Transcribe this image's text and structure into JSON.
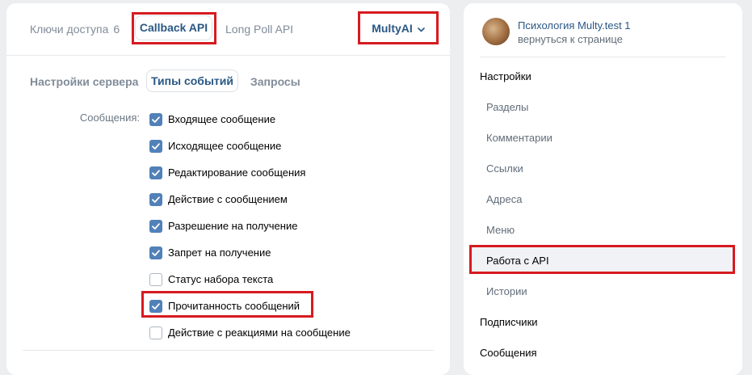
{
  "left_panel": {
    "top_tabs": {
      "keys_label": "Ключи доступа",
      "keys_count": "6",
      "callback": "Callback API",
      "longpoll": "Long Poll API",
      "app_name": "MultyAI"
    },
    "sub_tabs": {
      "server_settings": "Настройки сервера",
      "event_types": "Типы событий",
      "requests": "Запросы"
    },
    "messages_group_label": "Сообщения:",
    "events": [
      {
        "label": "Входящее сообщение",
        "checked": true
      },
      {
        "label": "Исходящее сообщение",
        "checked": true
      },
      {
        "label": "Редактирование сообщения",
        "checked": true
      },
      {
        "label": "Действие с сообщением",
        "checked": true
      },
      {
        "label": "Разрешение на получение",
        "checked": true
      },
      {
        "label": "Запрет на получение",
        "checked": true
      },
      {
        "label": "Статус набора текста",
        "checked": false
      },
      {
        "label": "Прочитанность сообщений",
        "checked": true
      },
      {
        "label": "Действие с реакциями на сообщение",
        "checked": false
      }
    ]
  },
  "right_panel": {
    "group_name": "Психология Multy.test 1",
    "back_link": "вернуться к странице",
    "menu": {
      "settings": "Настройки",
      "sections": "Разделы",
      "comments": "Комментарии",
      "links": "Ссылки",
      "addresses": "Адреса",
      "menu": "Меню",
      "api": "Работа с API",
      "stories": "Истории",
      "subscribers": "Подписчики",
      "messages": "Сообщения"
    }
  },
  "colors": {
    "accent": "#2a5885",
    "checkbox": "#5181b8",
    "highlight": "#d61b20"
  }
}
